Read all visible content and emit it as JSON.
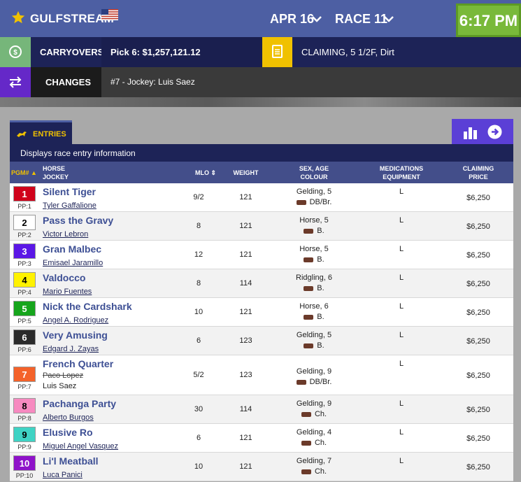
{
  "header": {
    "track": "GULFSTREAM",
    "date": "APR 16",
    "race": "RACE 11",
    "time": "6:17 PM"
  },
  "carryovers": {
    "label": "CARRYOVERS",
    "value": "Pick 6: $1,257,121.12",
    "race_info": "CLAIMING, 5 1/2F, Dirt"
  },
  "changes": {
    "label": "CHANGES",
    "value": "#7 - Jockey: Luis Saez"
  },
  "entries": {
    "tab_label": "ENTRIES",
    "description": "Displays race entry information",
    "columns": {
      "pgm": "PGM#",
      "horse": "HORSE",
      "jockey": "JOCKEY",
      "mlo": "MLO",
      "weight": "WEIGHT",
      "sex_age": "SEX, AGE",
      "colour": "COLOUR",
      "medications": "MEDICATIONS",
      "equipment": "EQUIPMENT",
      "claiming": "CLAIMING",
      "price": "PRICE"
    },
    "rows": [
      {
        "pgm": "1",
        "pp": "PP:1",
        "horse": "Silent Tiger",
        "jockey": "Tyler Gaffalione",
        "mlo": "9/2",
        "weight": "121",
        "sex_age": "Gelding, 5",
        "colour": "DB/Br.",
        "med": "L",
        "price": "$6,250",
        "color": "#d0021b",
        "text": "#ffffff"
      },
      {
        "pgm": "2",
        "pp": "PP:2",
        "horse": "Pass the Gravy",
        "jockey": "Victor Lebron",
        "mlo": "8",
        "weight": "121",
        "sex_age": "Horse, 5",
        "colour": "B.",
        "med": "L",
        "price": "$6,250",
        "color": "#ffffff",
        "text": "#000000"
      },
      {
        "pgm": "3",
        "pp": "PP:3",
        "horse": "Gran Malbec",
        "jockey": "Emisael Jaramillo",
        "mlo": "12",
        "weight": "121",
        "sex_age": "Horse, 5",
        "colour": "B.",
        "med": "L",
        "price": "$6,250",
        "color": "#5b17e6",
        "text": "#ffffff"
      },
      {
        "pgm": "4",
        "pp": "PP:4",
        "horse": "Valdocco",
        "jockey": "Mario Fuentes",
        "mlo": "8",
        "weight": "114",
        "sex_age": "Ridgling, 6",
        "colour": "B.",
        "med": "L",
        "price": "$6,250",
        "color": "#fff200",
        "text": "#000000"
      },
      {
        "pgm": "5",
        "pp": "PP:5",
        "horse": "Nick the Cardshark",
        "jockey": "Angel A. Rodriguez",
        "mlo": "10",
        "weight": "121",
        "sex_age": "Horse, 6",
        "colour": "B.",
        "med": "L",
        "price": "$6,250",
        "color": "#16a51c",
        "text": "#ffffff"
      },
      {
        "pgm": "6",
        "pp": "PP:6",
        "horse": "Very Amusing",
        "jockey": "Edgard J. Zayas",
        "mlo": "6",
        "weight": "123",
        "sex_age": "Gelding, 5",
        "colour": "B.",
        "med": "L",
        "price": "$6,250",
        "color": "#2a2a2a",
        "text": "#ffffff"
      },
      {
        "pgm": "7",
        "pp": "PP:7",
        "horse": "French Quarter",
        "jockey": "Paco Lopez",
        "jockey_new": "Luis Saez",
        "mlo": "5/2",
        "weight": "123",
        "sex_age": "Gelding, 9",
        "colour": "DB/Br.",
        "med": "L",
        "price": "$6,250",
        "color": "#f4622a",
        "text": "#ffffff"
      },
      {
        "pgm": "8",
        "pp": "PP:8",
        "horse": "Pachanga Party",
        "jockey": "Alberto Burgos",
        "mlo": "30",
        "weight": "114",
        "sex_age": "Gelding, 9",
        "colour": "Ch.",
        "med": "L",
        "price": "$6,250",
        "color": "#f78ac0",
        "text": "#000000"
      },
      {
        "pgm": "9",
        "pp": "PP:9",
        "horse": "Elusive Ro",
        "jockey": "Miguel Angel Vasquez",
        "mlo": "6",
        "weight": "121",
        "sex_age": "Gelding, 4",
        "colour": "Ch.",
        "med": "L",
        "price": "$6,250",
        "color": "#3fd3c4",
        "text": "#000000"
      },
      {
        "pgm": "10",
        "pp": "PP:10",
        "horse": "Li'l Meatball",
        "jockey": "Luca Panici",
        "mlo": "10",
        "weight": "121",
        "sex_age": "Gelding, 7",
        "colour": "Ch.",
        "med": "L",
        "price": "$6,250",
        "color": "#8e12c9",
        "text": "#ffffff"
      }
    ]
  }
}
